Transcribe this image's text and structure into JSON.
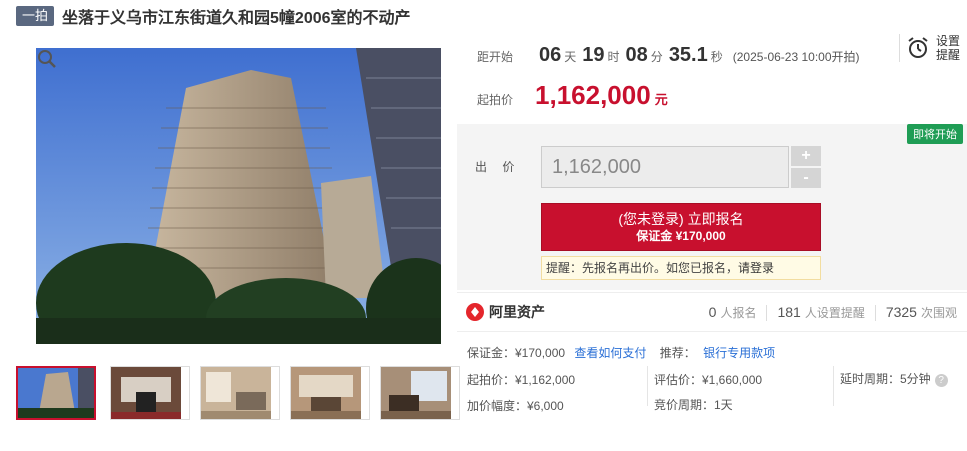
{
  "header": {
    "badge": "一拍",
    "title": "坐落于义乌市江东街道久和园5幢2006室的不动产"
  },
  "countdown": {
    "label": "距开始",
    "days": "06",
    "days_unit": "天",
    "hours": "19",
    "hours_unit": "时",
    "minutes": "08",
    "minutes_unit": "分",
    "seconds": "35.1",
    "seconds_unit": "秒",
    "start_time": "(2025-06-23 10:00开拍)"
  },
  "reminder": {
    "label_line1": "设置",
    "label_line2": "提醒",
    "icon": "alarm-clock-icon"
  },
  "start_price": {
    "label": "起拍价",
    "value": "1,162,000",
    "unit": "元"
  },
  "bid": {
    "status_badge": "即将开始",
    "label": "出 价",
    "input_value": "1,162,000",
    "plus": "+",
    "minus": "-",
    "signup_main": "(您未登录) 立即报名",
    "signup_deposit": "保证金 ¥170,000",
    "tip_text": "提醒：先报名再出价。如您已报名，",
    "tip_link": "请登录"
  },
  "platform": {
    "name": "阿里资产",
    "signups": "0",
    "signups_label": "人报名",
    "reminders": "181",
    "reminders_label": "人设置提醒",
    "views": "7325",
    "views_label": "次围观"
  },
  "details": {
    "deposit_label": "保证金：¥170,000",
    "deposit_link": "查看如何支付",
    "recommend_label": "推荐：",
    "recommend_link": "银行专用款项",
    "start_price": "起拍价：¥1,162,000",
    "appraisal": "评估价：¥1,660,000",
    "extension": "延时周期：5分钟",
    "increment": "加价幅度：¥6,000",
    "bid_cycle": "竞价周期：1天"
  },
  "colors": {
    "accent": "#c8102e",
    "badge_green": "#1f9d55",
    "link": "#2a6fd6"
  }
}
